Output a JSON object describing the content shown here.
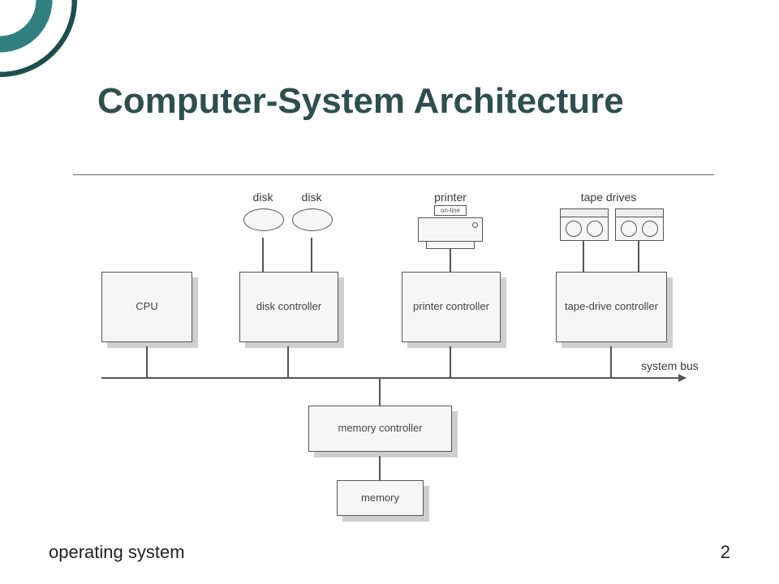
{
  "title": "Computer-System Architecture",
  "footer": {
    "left": "operating system",
    "page": "2"
  },
  "devices": {
    "disk1": "disk",
    "disk2": "disk",
    "printer": "printer",
    "printer_display": "on-line",
    "tapedrives": "tape drives"
  },
  "controllers": {
    "cpu": "CPU",
    "disk": "disk controller",
    "printer": "printer controller",
    "tape": "tape-drive controller",
    "memctrl": "memory controller",
    "memory": "memory"
  },
  "bus_label": "system bus"
}
